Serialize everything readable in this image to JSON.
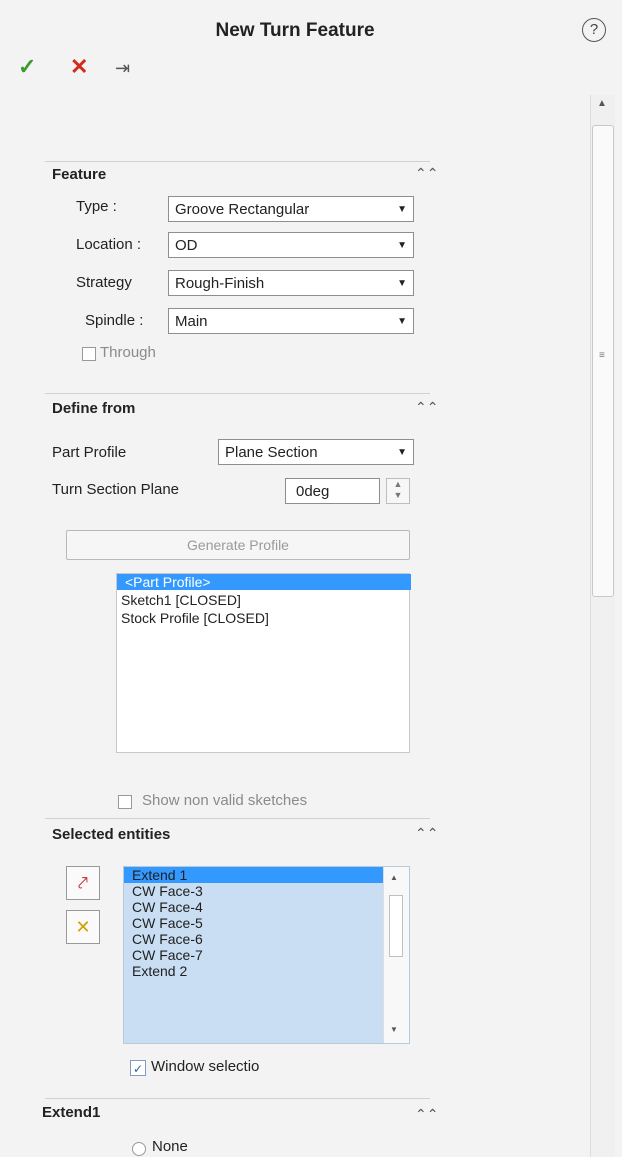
{
  "window": {
    "title": "New Turn Feature",
    "help_icon": "?"
  },
  "toolbar": {
    "ok_icon": "✓",
    "cancel_icon": "✕",
    "pin_icon": "⇥"
  },
  "sections": {
    "feature": {
      "title": "Feature",
      "type_label": "Type :",
      "type_value": "Groove Rectangular",
      "location_label": "Location :",
      "location_value": "OD",
      "strategy_label": "Strategy",
      "strategy_value": "Rough-Finish",
      "spindle_label": "Spindle :",
      "spindle_value": "Main",
      "through_label": "Through"
    },
    "define_from": {
      "title": "Define from",
      "part_profile_label": "Part Profile",
      "part_profile_value": "Plane Section",
      "turn_section_label": "Turn Section Plane",
      "turn_section_value": "0deg",
      "generate_button": "Generate Profile",
      "profiles": [
        "<Part Profile>",
        "Sketch1 [CLOSED]",
        "Stock Profile [CLOSED]"
      ],
      "show_invalid_label": "Show non valid sketches"
    },
    "selected_entities": {
      "title": "Selected entities",
      "entities": [
        "Extend 1",
        "CW Face-3",
        "CW Face-4",
        "CW Face-5",
        "CW Face-6",
        "CW Face-7",
        "Extend 2"
      ],
      "window_selection_label": "Window selectio"
    },
    "extend1": {
      "title": "Extend1",
      "none_label": "None"
    }
  }
}
